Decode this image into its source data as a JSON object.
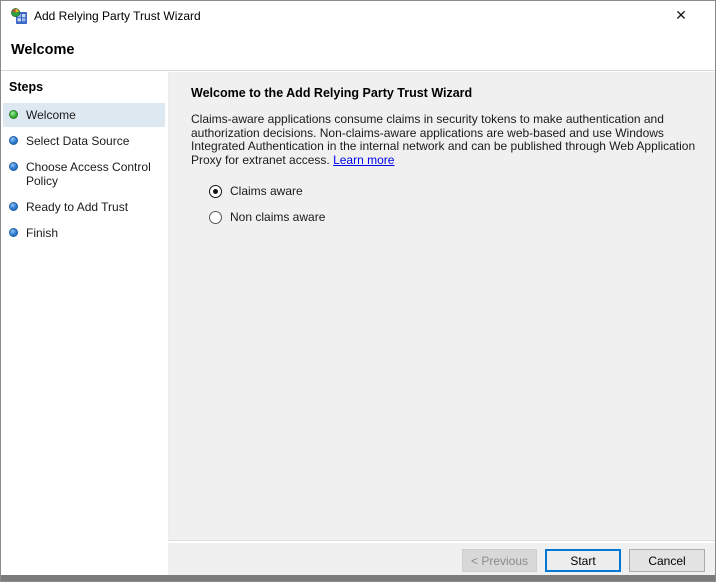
{
  "window": {
    "title": "Add Relying Party Trust Wizard",
    "close_icon": "✕"
  },
  "page_header": "Welcome",
  "sidebar": {
    "title": "Steps",
    "steps": [
      {
        "label": "Welcome",
        "active": true,
        "bullet": "green-dot",
        "bullet_color": "#3cb53c"
      },
      {
        "label": "Select Data Source",
        "active": false,
        "bullet": "blue-dot",
        "bullet_color": "#2e7cd6"
      },
      {
        "label": "Choose Access Control Policy",
        "active": false,
        "bullet": "blue-dot",
        "bullet_color": "#2e7cd6"
      },
      {
        "label": "Ready to Add Trust",
        "active": false,
        "bullet": "blue-dot",
        "bullet_color": "#2e7cd6"
      },
      {
        "label": "Finish",
        "active": false,
        "bullet": "blue-dot",
        "bullet_color": "#2e7cd6"
      }
    ]
  },
  "content": {
    "heading": "Welcome to the Add Relying Party Trust Wizard",
    "body_lines": [
      "Claims-aware applications consume claims in security tokens to make authentication and",
      "authorization decisions. Non-claims-aware applications are web-based and use Windows",
      "Integrated Authentication in the internal network and can be published through Web Application",
      "Proxy for extranet access."
    ],
    "learn_more": "Learn more",
    "options": [
      {
        "label": "Claims aware",
        "selected": true
      },
      {
        "label": "Non claims aware",
        "selected": false
      }
    ]
  },
  "footer": {
    "buttons": [
      {
        "label": "< Previous",
        "enabled": false
      },
      {
        "label": "Start",
        "enabled": true,
        "is_default": true
      },
      {
        "label": "Cancel",
        "enabled": true
      }
    ]
  },
  "colors": {
    "accent": "#0078d7",
    "link": "#0000ee",
    "panel_bg": "#f0f0f0",
    "sidebar_bg": "#ffffff",
    "active_step_bg": "#dde8f0",
    "current_step_bullet": "#3cb53c",
    "pending_step_bullet": "#2e7cd6",
    "window_border": "#8b8b8b"
  }
}
